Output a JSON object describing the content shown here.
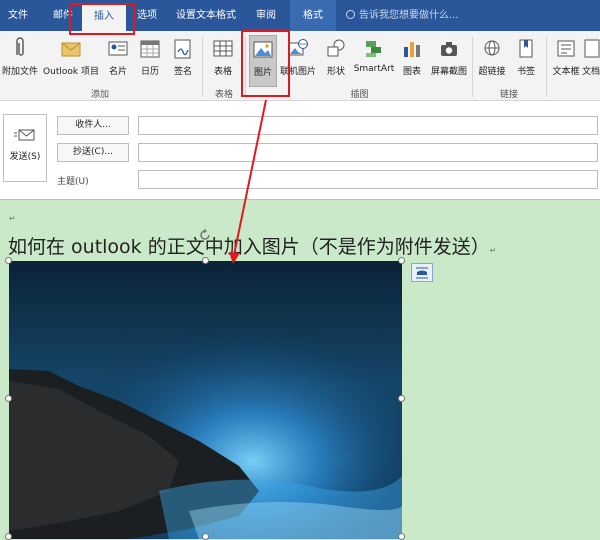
{
  "tabs": {
    "file": "文件",
    "mail": "邮件",
    "insert": "插入",
    "options": "选项",
    "format_text": "设置文本格式",
    "review": "审阅",
    "format": "格式",
    "tell_me": "告诉我您想要做什么..."
  },
  "ribbon": {
    "attach_file": "附加文件",
    "outlook_item": "Outlook 项目",
    "business_card": "名片",
    "calendar": "日历",
    "signature": "签名",
    "group_include": "添加",
    "table": "表格",
    "group_tables": "表格",
    "pictures": "图片",
    "online_pictures": "联机图片",
    "shapes": "形状",
    "smartart": "SmartArt",
    "chart": "图表",
    "screenshot": "屏幕截图",
    "group_illustrations": "插图",
    "hyperlink": "超链接",
    "bookmark": "书签",
    "group_links": "链接",
    "textbox": "文本框",
    "text_more": "文档"
  },
  "compose": {
    "send": "发送(S)",
    "to": "收件人...",
    "cc": "抄送(C)...",
    "subject": "主题(U)",
    "to_value": "",
    "cc_value": "",
    "subject_value": ""
  },
  "body": {
    "heading": "如何在 outlook 的正文中加入图片（不是作为附件发送）",
    "para_mark": "↵"
  },
  "colors": {
    "ribbon_blue": "#2b579a",
    "annotation_red": "#e0191f",
    "body_green": "#c9e9c9"
  }
}
